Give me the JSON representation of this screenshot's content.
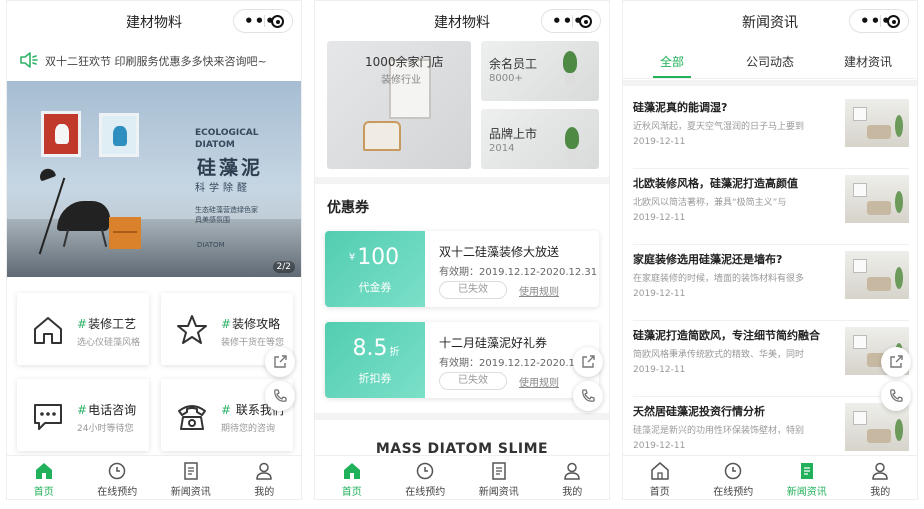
{
  "colors": {
    "accent": "#21b15a",
    "coupon": "#52cdb0"
  },
  "tabbar": {
    "items": [
      {
        "label": "首页",
        "icon": "home-icon"
      },
      {
        "label": "在线预约",
        "icon": "clock-icon"
      },
      {
        "label": "新闻资讯",
        "icon": "news-icon"
      },
      {
        "label": "我的",
        "icon": "user-icon"
      }
    ]
  },
  "screen1": {
    "title": "建材物料",
    "notice": "双十二狂欢节 印刷服务优惠多多快来咨询吧~",
    "banner": {
      "en_line1": "ECOLOGICAL",
      "en_line2": "DIATOM",
      "cn_title": "硅藻泥",
      "cn_sub": "科学除醛",
      "small1": "生态硅藻营造绿色家",
      "small2": "具美感氛围",
      "brand": "DIATOM",
      "pager": "2/2"
    },
    "menu": [
      {
        "title": "装修工艺",
        "sub": "选心仪硅藻风格",
        "icon": "house-icon"
      },
      {
        "title": "装修攻略",
        "sub": "装修干货在等您",
        "icon": "star-icon"
      },
      {
        "title": "电话咨询",
        "sub": "24小时等待您",
        "icon": "chat-icon"
      },
      {
        "title": " 联系我们",
        "sub": "期待您的咨询",
        "icon": "phone-icon"
      }
    ]
  },
  "screen2": {
    "title": "建材物料",
    "stats": [
      {
        "title": "1000余家门店",
        "sub": "装修行业"
      },
      {
        "title": "余名员工",
        "sub": "8000+"
      },
      {
        "title": "品牌上市",
        "sub": "2014"
      }
    ],
    "section_title": "优惠券",
    "coupons": [
      {
        "prefix": "¥",
        "amount": "100",
        "suffix": "",
        "kind": "代金券",
        "name": "双十二硅藻装修大放送",
        "date": "有效期：2019.12.12-2020.12.31",
        "status": "已失效",
        "rule": "使用规则"
      },
      {
        "prefix": "",
        "amount": "8.5",
        "suffix": "折",
        "kind": "折扣券",
        "name": "十二月硅藻泥好礼券",
        "date": "有效期：2019.12.12-2020.12.31",
        "status": "已失效",
        "rule": "使用规则"
      }
    ],
    "mass_title": "MASS DIATOM SLIME"
  },
  "screen3": {
    "title": "新闻资讯",
    "tabs": [
      "全部",
      "公司动态",
      "建材资讯"
    ],
    "news": [
      {
        "title": "硅藻泥真的能调湿?",
        "desc": "近秋风渐起，夏天空气湿润的日子马上要到",
        "date": "2019-12-11"
      },
      {
        "title": "北欧装修风格，硅藻泥打造高颜值",
        "desc": "北欧风以简洁著称，兼具“极简主义”与",
        "date": "2019-12-11"
      },
      {
        "title": "家庭装修选用硅藻泥还是墙布?",
        "desc": "在家庭装修的时候，墙面的装饰材料有很多",
        "date": "2019-12-11"
      },
      {
        "title": "硅藻泥打造简欧风，专注细节简约融合",
        "desc": "简欧风格秉承传统欧式的精致、华美，同时",
        "date": "2019-12-11"
      },
      {
        "title": "天然居硅藻泥投资行情分析",
        "desc": "硅藻泥是新兴的功用性环保装饰壁材，特别",
        "date": "2019-12-11"
      }
    ]
  }
}
